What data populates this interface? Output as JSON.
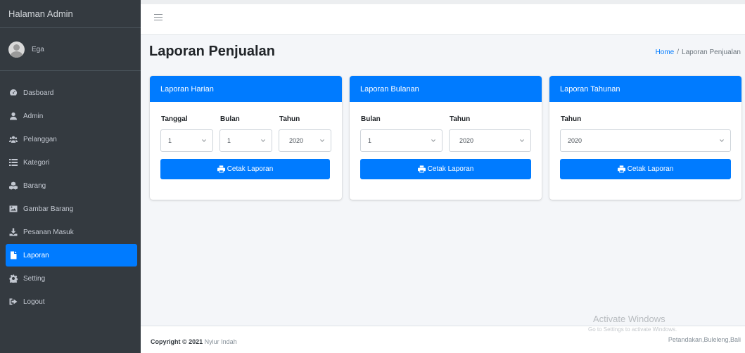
{
  "brand": "Halaman Admin",
  "user": {
    "name": "Ega"
  },
  "sidebar": {
    "items": [
      {
        "label": "Dasboard",
        "icon": "dashboard-icon"
      },
      {
        "label": "Admin",
        "icon": "user-icon"
      },
      {
        "label": "Pelanggan",
        "icon": "users-icon"
      },
      {
        "label": "Kategori",
        "icon": "list-icon"
      },
      {
        "label": "Barang",
        "icon": "cubes-icon"
      },
      {
        "label": "Gambar Barang",
        "icon": "image-icon"
      },
      {
        "label": "Pesanan Masuk",
        "icon": "download-icon"
      },
      {
        "label": "Laporan",
        "icon": "file-icon",
        "active": true
      },
      {
        "label": "Setting",
        "icon": "gear-icon"
      },
      {
        "label": "Logout",
        "icon": "sign-out-icon"
      }
    ]
  },
  "page": {
    "title": "Laporan Penjualan"
  },
  "breadcrumb": {
    "home": "Home",
    "separator": "/",
    "current": "Laporan Penjualan"
  },
  "cards": {
    "harian": {
      "title": "Laporan Harian",
      "labels": {
        "tanggal": "Tanggal",
        "bulan": "Bulan",
        "tahun": "Tahun"
      },
      "values": {
        "tanggal": "1",
        "bulan": "1",
        "tahun": "2020"
      },
      "button": "Cetak Laporan"
    },
    "bulanan": {
      "title": "Laporan Bulanan",
      "labels": {
        "bulan": "Bulan",
        "tahun": "Tahun"
      },
      "values": {
        "bulan": "1",
        "tahun": "2020"
      },
      "button": "Cetak Laporan"
    },
    "tahunan": {
      "title": "Laporan Tahunan",
      "labels": {
        "tahun": "Tahun"
      },
      "values": {
        "tahun": "2020"
      },
      "button": "Cetak Laporan"
    }
  },
  "footer": {
    "copyright_prefix": "Copyright © 2021",
    "copyright_name": "Nyiur Indah",
    "address": "Petandakan,Buleleng,Bali"
  },
  "watermark": {
    "title": "Activate Windows",
    "subtitle": "Go to Settings to activate Windows."
  },
  "colors": {
    "primary": "#007bff",
    "sidebar": "#343a40",
    "background": "#f4f6f9"
  }
}
